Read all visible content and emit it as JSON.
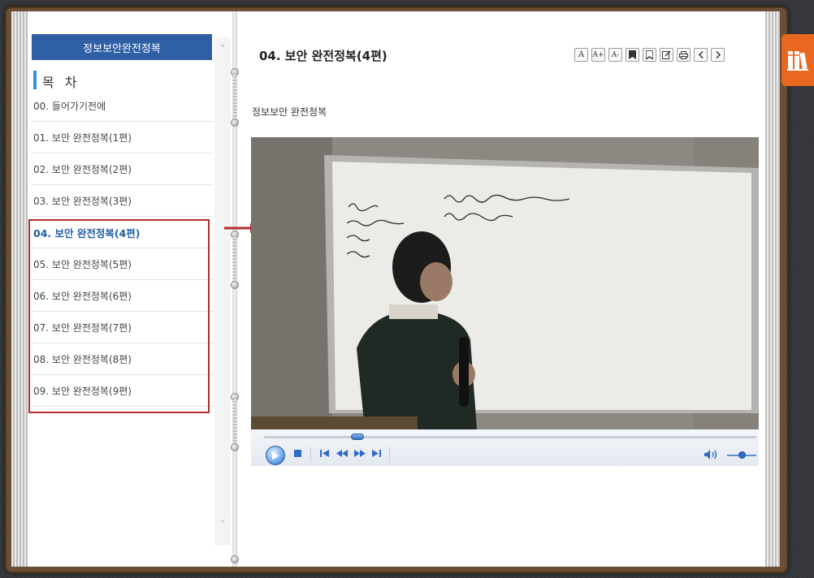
{
  "sidebar": {
    "header": "정보보안완전정복",
    "toc_title": "목 차",
    "items": [
      {
        "label": "00. 들어가기전에"
      },
      {
        "label": "01. 보안 완전정복(1편)"
      },
      {
        "label": "02. 보안 완전정복(2편)"
      },
      {
        "label": "03. 보안 완전정복(3편)"
      },
      {
        "label": "04. 보안 완전정복(4편)"
      },
      {
        "label": "05. 보안 완전정복(5편)"
      },
      {
        "label": "06. 보안 완전정복(6편)"
      },
      {
        "label": "07. 보안 완전정복(7편)"
      },
      {
        "label": "08. 보안 완전정복(8편)"
      },
      {
        "label": "09. 보안 완전정복(9편)"
      }
    ],
    "active_index": 4
  },
  "content": {
    "title": "04. 보안 완전정복(4편)",
    "subtitle": "정보보안 완전정복"
  },
  "toolbar": {
    "font_reset": "A",
    "font_increase": "A+",
    "font_decrease": "A-"
  },
  "player": {
    "seek_fraction": 0.19,
    "volume_fraction": 0.5
  },
  "colors": {
    "accent": "#2f5fa5",
    "active_item": "#1e5fa6",
    "highlight": "#b52b2b",
    "library_tab": "#e8681f"
  },
  "icons": {
    "library": "books-icon",
    "bookmark": "bookmark-icon",
    "memo": "memo-icon",
    "print": "print-icon"
  }
}
